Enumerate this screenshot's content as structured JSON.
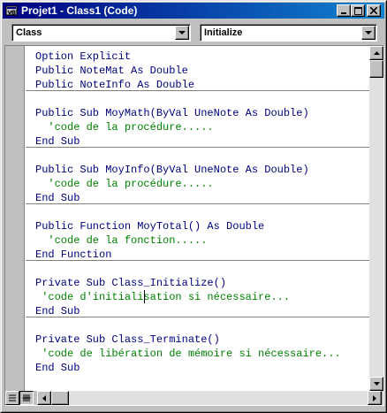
{
  "window": {
    "title": "Projet1 - Class1 (Code)",
    "colors": {
      "titlebar_start": "#000080",
      "titlebar_end": "#1084d0",
      "keyword": "#000080",
      "comment": "#008000"
    }
  },
  "toolbar": {
    "object_combo_value": "Class",
    "procedure_combo_value": "Initialize"
  },
  "code": {
    "blocks": [
      {
        "lines": [
          {
            "text": "Option Explicit",
            "kind": "code"
          },
          {
            "text": "Public NoteMat As Double",
            "kind": "code"
          },
          {
            "text": "Public NoteInfo As Double",
            "kind": "code"
          }
        ]
      },
      {
        "lines": [
          {
            "text": "Public Sub MoyMath(ByVal UneNote As Double)",
            "kind": "code"
          },
          {
            "text": "  'code de la procédure.....",
            "kind": "comment"
          },
          {
            "text": "End Sub",
            "kind": "code"
          }
        ]
      },
      {
        "lines": [
          {
            "text": "Public Sub MoyInfo(ByVal UneNote As Double)",
            "kind": "code"
          },
          {
            "text": "  'code de la procédure.....",
            "kind": "comment"
          },
          {
            "text": "End Sub",
            "kind": "code"
          }
        ]
      },
      {
        "lines": [
          {
            "text": "Public Function MoyTotal() As Double",
            "kind": "code"
          },
          {
            "text": "  'code de la fonction.....",
            "kind": "comment"
          },
          {
            "text": "End Function",
            "kind": "code"
          }
        ]
      },
      {
        "lines": [
          {
            "text": "Private Sub Class_Initialize()",
            "kind": "code"
          },
          {
            "text": " 'code d'initialisation si nécessaire...",
            "kind": "comment"
          },
          {
            "text": "End Sub",
            "kind": "code"
          }
        ]
      },
      {
        "lines": [
          {
            "text": "Private Sub Class_Terminate()",
            "kind": "code"
          },
          {
            "text": " 'code de libération de mémoire si nécessaire...",
            "kind": "comment"
          },
          {
            "text": "End Sub",
            "kind": "code"
          }
        ]
      }
    ]
  },
  "icons": {
    "app": "vb-code-window-icon",
    "minimize": "minimize-icon",
    "maximize": "maximize-icon",
    "close": "close-icon",
    "dropdown": "chevron-down-icon",
    "procedure_view": "procedure-view-icon",
    "full_module_view": "full-module-view-icon"
  }
}
